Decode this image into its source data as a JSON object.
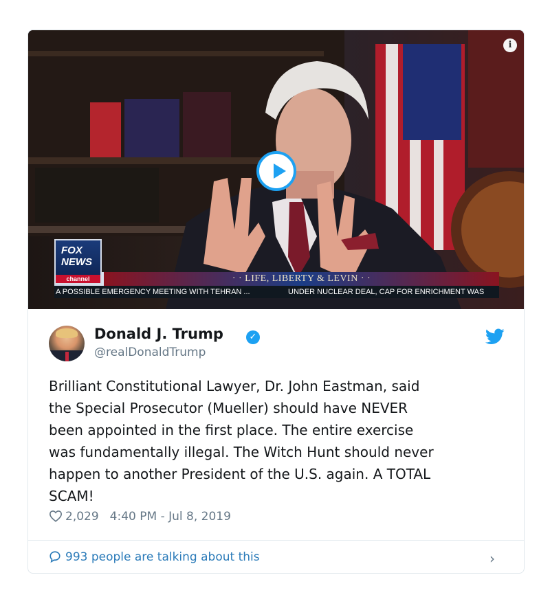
{
  "media": {
    "network_logo_line1": "FOX",
    "network_logo_line2": "NEWS",
    "network_logo_sub": "channel",
    "show_title": "· · LIFE, LIBERTY & LEVIN · ·",
    "ticker_left": "A POSSIBLE EMERGENCY MEETING WITH TEHRAN ...",
    "ticker_right": "UNDER NUCLEAR DEAL, CAP FOR ENRICHMENT WAS",
    "info_icon": "info-icon",
    "play_icon": "play-icon"
  },
  "tweet": {
    "author_name": "Donald J. Trump",
    "author_handle": "@realDonaldTrump",
    "verified_icon": "verified-badge-icon",
    "platform_icon": "twitter-bird-icon",
    "text": "Brilliant Constitutional Lawyer, Dr. John Eastman, said\nthe Special Prosecutor (Mueller) should have NEVER\nbeen appointed in the first place. The entire exercise\nwas fundamentally illegal. The Witch Hunt should never\nhappen to another President of the U.S. again. A TOTAL\nSCAM!",
    "likes": "2,029",
    "timestamp": "4:40 PM - Jul 8, 2019",
    "talking": "993 people are talking about this"
  },
  "colors": {
    "accent": "#1da1f2",
    "link": "#2b7bb9",
    "secondary_text": "#657786",
    "primary_text": "#14171a"
  }
}
